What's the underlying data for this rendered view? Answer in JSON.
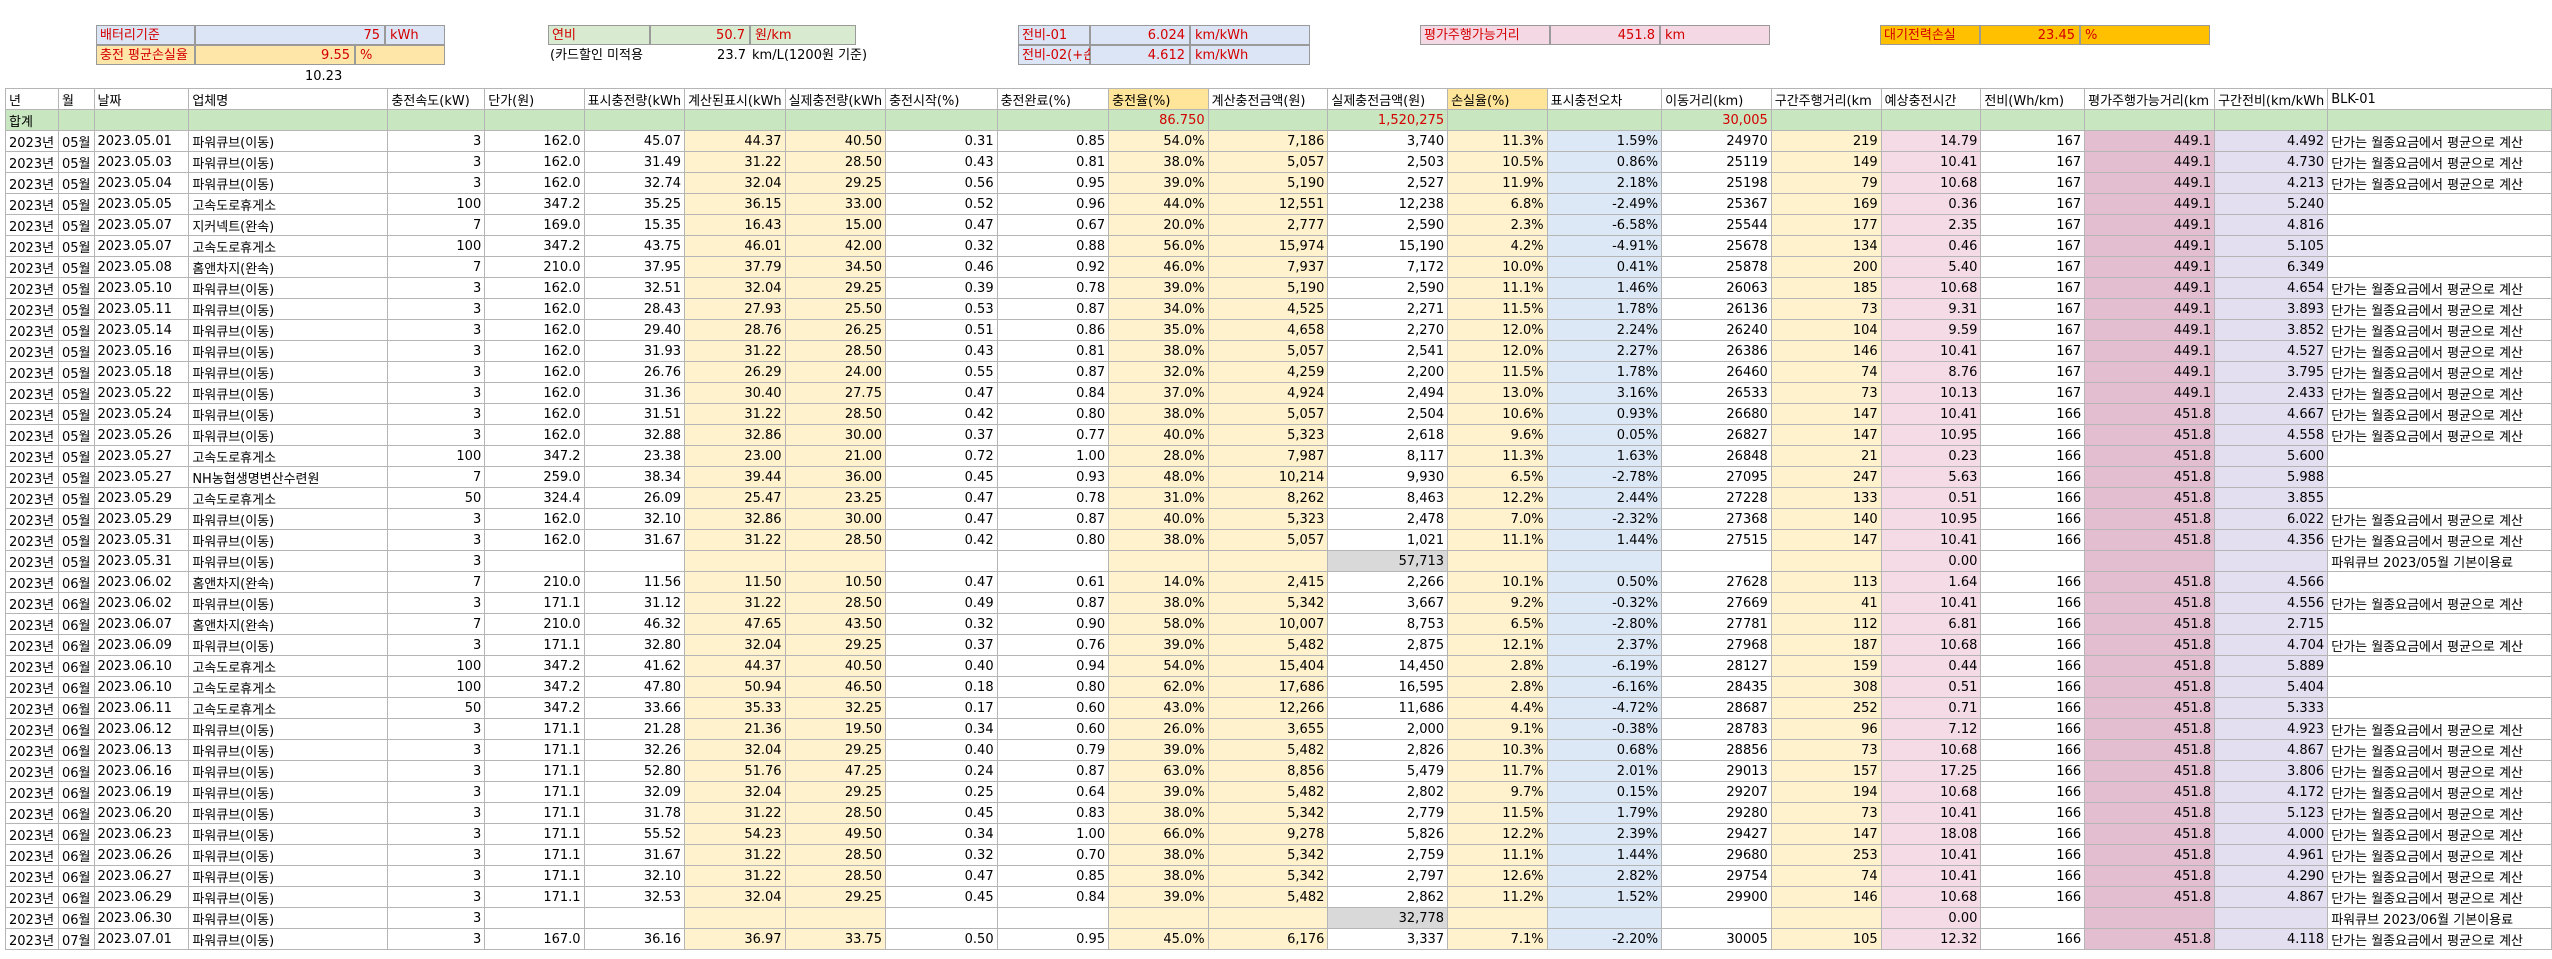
{
  "header": {
    "battery_label": "배터리기준",
    "battery_value": "75",
    "battery_unit": "kWh",
    "charge_loss_label": "충전 평균손실율",
    "charge_loss_value": "9.55",
    "charge_loss_unit": "%",
    "below_value": "10.23",
    "fuel_label": "연비",
    "fuel_value": "50.7",
    "fuel_unit": "원/km",
    "discount_note": "(카드할인 미적용",
    "discount_value": "23.7",
    "discount_unit": "km/L(1200원 기준)",
    "eff1_label": "전비-01",
    "eff1_value": "6.024",
    "eff1_unit": "km/kWh",
    "eff2_label": "전비-02(+손실)",
    "eff2_value": "4.612",
    "eff2_unit": "km/kWh",
    "range_label": "평가주행가능거리",
    "range_value": "451.8",
    "range_unit": "km",
    "standby_label": "대기전력손실",
    "standby_value": "23.45",
    "standby_unit": "%"
  },
  "table": {
    "columns": [
      "년",
      "월",
      "날짜",
      "업체명",
      "충전속도(kW)",
      "단가(원)",
      "표시충전량(kWh",
      "계산된표시(kWh",
      "실제충전량(kWh",
      "충전시작(%)",
      "충전완료(%)",
      "충전율(%)",
      "계산충전금액(원)",
      "실제충전금액(원)",
      "손실율(%)",
      "표시충전오차",
      "이동거리(km)",
      "구간주행거리(km",
      "예상충전시간",
      "전비(Wh/km)",
      "평가주행가능거리(km",
      "구간전비(km/kWh",
      "BLK-01"
    ],
    "summary": {
      "label": "합계",
      "charge_rate": "86.750",
      "actual_amount": "1,520,275",
      "distance": "30,005"
    },
    "rows": [
      [
        "2023년",
        "05월",
        "2023.05.01",
        "파워큐브(이동)",
        "3",
        "162.0",
        "45.07",
        "44.37",
        "40.50",
        "0.31",
        "0.85",
        "54.0%",
        "7,186",
        "3,740",
        "11.3%",
        "1.59%",
        "24970",
        "219",
        "14.79",
        "167",
        "449.1",
        "4.492",
        "단가는 월종요금에서 평균으로 계산"
      ],
      [
        "2023년",
        "05월",
        "2023.05.03",
        "파워큐브(이동)",
        "3",
        "162.0",
        "31.49",
        "31.22",
        "28.50",
        "0.43",
        "0.81",
        "38.0%",
        "5,057",
        "2,503",
        "10.5%",
        "0.86%",
        "25119",
        "149",
        "10.41",
        "167",
        "449.1",
        "4.730",
        "단가는 월종요금에서 평균으로 계산"
      ],
      [
        "2023년",
        "05월",
        "2023.05.04",
        "파워큐브(이동)",
        "3",
        "162.0",
        "32.74",
        "32.04",
        "29.25",
        "0.56",
        "0.95",
        "39.0%",
        "5,190",
        "2,527",
        "11.9%",
        "2.18%",
        "25198",
        "79",
        "10.68",
        "167",
        "449.1",
        "4.213",
        "단가는 월종요금에서 평균으로 계산"
      ],
      [
        "2023년",
        "05월",
        "2023.05.05",
        "고속도로휴게소",
        "100",
        "347.2",
        "35.25",
        "36.15",
        "33.00",
        "0.52",
        "0.96",
        "44.0%",
        "12,551",
        "12,238",
        "6.8%",
        "-2.49%",
        "25367",
        "169",
        "0.36",
        "167",
        "449.1",
        "5.240",
        ""
      ],
      [
        "2023년",
        "05월",
        "2023.05.07",
        "지커넥트(완속)",
        "7",
        "169.0",
        "15.35",
        "16.43",
        "15.00",
        "0.47",
        "0.67",
        "20.0%",
        "2,777",
        "2,590",
        "2.3%",
        "-6.58%",
        "25544",
        "177",
        "2.35",
        "167",
        "449.1",
        "4.816",
        ""
      ],
      [
        "2023년",
        "05월",
        "2023.05.07",
        "고속도로휴게소",
        "100",
        "347.2",
        "43.75",
        "46.01",
        "42.00",
        "0.32",
        "0.88",
        "56.0%",
        "15,974",
        "15,190",
        "4.2%",
        "-4.91%",
        "25678",
        "134",
        "0.46",
        "167",
        "449.1",
        "5.105",
        ""
      ],
      [
        "2023년",
        "05월",
        "2023.05.08",
        "홈앤차지(완속)",
        "7",
        "210.0",
        "37.95",
        "37.79",
        "34.50",
        "0.46",
        "0.92",
        "46.0%",
        "7,937",
        "7,172",
        "10.0%",
        "0.41%",
        "25878",
        "200",
        "5.40",
        "167",
        "449.1",
        "6.349",
        ""
      ],
      [
        "2023년",
        "05월",
        "2023.05.10",
        "파워큐브(이동)",
        "3",
        "162.0",
        "32.51",
        "32.04",
        "29.25",
        "0.39",
        "0.78",
        "39.0%",
        "5,190",
        "2,590",
        "11.1%",
        "1.46%",
        "26063",
        "185",
        "10.68",
        "167",
        "449.1",
        "4.654",
        "단가는 월종요금에서 평균으로 계산"
      ],
      [
        "2023년",
        "05월",
        "2023.05.11",
        "파워큐브(이동)",
        "3",
        "162.0",
        "28.43",
        "27.93",
        "25.50",
        "0.53",
        "0.87",
        "34.0%",
        "4,525",
        "2,271",
        "11.5%",
        "1.78%",
        "26136",
        "73",
        "9.31",
        "167",
        "449.1",
        "3.893",
        "단가는 월종요금에서 평균으로 계산"
      ],
      [
        "2023년",
        "05월",
        "2023.05.14",
        "파워큐브(이동)",
        "3",
        "162.0",
        "29.40",
        "28.76",
        "26.25",
        "0.51",
        "0.86",
        "35.0%",
        "4,658",
        "2,270",
        "12.0%",
        "2.24%",
        "26240",
        "104",
        "9.59",
        "167",
        "449.1",
        "3.852",
        "단가는 월종요금에서 평균으로 계산"
      ],
      [
        "2023년",
        "05월",
        "2023.05.16",
        "파워큐브(이동)",
        "3",
        "162.0",
        "31.93",
        "31.22",
        "28.50",
        "0.43",
        "0.81",
        "38.0%",
        "5,057",
        "2,541",
        "12.0%",
        "2.27%",
        "26386",
        "146",
        "10.41",
        "167",
        "449.1",
        "4.527",
        "단가는 월종요금에서 평균으로 계산"
      ],
      [
        "2023년",
        "05월",
        "2023.05.18",
        "파워큐브(이동)",
        "3",
        "162.0",
        "26.76",
        "26.29",
        "24.00",
        "0.55",
        "0.87",
        "32.0%",
        "4,259",
        "2,200",
        "11.5%",
        "1.78%",
        "26460",
        "74",
        "8.76",
        "167",
        "449.1",
        "3.795",
        "단가는 월종요금에서 평균으로 계산"
      ],
      [
        "2023년",
        "05월",
        "2023.05.22",
        "파워큐브(이동)",
        "3",
        "162.0",
        "31.36",
        "30.40",
        "27.75",
        "0.47",
        "0.84",
        "37.0%",
        "4,924",
        "2,494",
        "13.0%",
        "3.16%",
        "26533",
        "73",
        "10.13",
        "167",
        "449.1",
        "2.433",
        "단가는 월종요금에서 평균으로 계산"
      ],
      [
        "2023년",
        "05월",
        "2023.05.24",
        "파워큐브(이동)",
        "3",
        "162.0",
        "31.51",
        "31.22",
        "28.50",
        "0.42",
        "0.80",
        "38.0%",
        "5,057",
        "2,504",
        "10.6%",
        "0.93%",
        "26680",
        "147",
        "10.41",
        "166",
        "451.8",
        "4.667",
        "단가는 월종요금에서 평균으로 계산"
      ],
      [
        "2023년",
        "05월",
        "2023.05.26",
        "파워큐브(이동)",
        "3",
        "162.0",
        "32.88",
        "32.86",
        "30.00",
        "0.37",
        "0.77",
        "40.0%",
        "5,323",
        "2,618",
        "9.6%",
        "0.05%",
        "26827",
        "147",
        "10.95",
        "166",
        "451.8",
        "4.558",
        "단가는 월종요금에서 평균으로 계산"
      ],
      [
        "2023년",
        "05월",
        "2023.05.27",
        "고속도로휴게소",
        "100",
        "347.2",
        "23.38",
        "23.00",
        "21.00",
        "0.72",
        "1.00",
        "28.0%",
        "7,987",
        "8,117",
        "11.3%",
        "1.63%",
        "26848",
        "21",
        "0.23",
        "166",
        "451.8",
        "5.600",
        ""
      ],
      [
        "2023년",
        "05월",
        "2023.05.27",
        "NH농협생명변산수련원",
        "7",
        "259.0",
        "38.34",
        "39.44",
        "36.00",
        "0.45",
        "0.93",
        "48.0%",
        "10,214",
        "9,930",
        "6.5%",
        "-2.78%",
        "27095",
        "247",
        "5.63",
        "166",
        "451.8",
        "5.988",
        ""
      ],
      [
        "2023년",
        "05월",
        "2023.05.29",
        "고속도로휴게소",
        "50",
        "324.4",
        "26.09",
        "25.47",
        "23.25",
        "0.47",
        "0.78",
        "31.0%",
        "8,262",
        "8,463",
        "12.2%",
        "2.44%",
        "27228",
        "133",
        "0.51",
        "166",
        "451.8",
        "3.855",
        ""
      ],
      [
        "2023년",
        "05월",
        "2023.05.29",
        "파워큐브(이동)",
        "3",
        "162.0",
        "32.10",
        "32.86",
        "30.00",
        "0.47",
        "0.87",
        "40.0%",
        "5,323",
        "2,478",
        "7.0%",
        "-2.32%",
        "27368",
        "140",
        "10.95",
        "166",
        "451.8",
        "6.022",
        "단가는 월종요금에서 평균으로 계산"
      ],
      [
        "2023년",
        "05월",
        "2023.05.31",
        "파워큐브(이동)",
        "3",
        "162.0",
        "31.67",
        "31.22",
        "28.50",
        "0.42",
        "0.80",
        "38.0%",
        "5,057",
        "1,021",
        "11.1%",
        "1.44%",
        "27515",
        "147",
        "10.41",
        "166",
        "451.8",
        "4.356",
        "단가는 월종요금에서 평균으로 계산"
      ],
      [
        "2023년",
        "05월",
        "2023.05.31",
        "파워큐브(이동)",
        "3",
        "",
        "",
        "",
        "",
        "",
        "",
        "",
        "",
        "57,713",
        "",
        "",
        "",
        "",
        "0.00",
        "",
        "",
        "",
        "파워큐브 2023/05월 기본이용료"
      ],
      [
        "2023년",
        "06월",
        "2023.06.02",
        "홈앤차지(완속)",
        "7",
        "210.0",
        "11.56",
        "11.50",
        "10.50",
        "0.47",
        "0.61",
        "14.0%",
        "2,415",
        "2,266",
        "10.1%",
        "0.50%",
        "27628",
        "113",
        "1.64",
        "166",
        "451.8",
        "4.566",
        ""
      ],
      [
        "2023년",
        "06월",
        "2023.06.02",
        "파워큐브(이동)",
        "3",
        "171.1",
        "31.12",
        "31.22",
        "28.50",
        "0.49",
        "0.87",
        "38.0%",
        "5,342",
        "3,667",
        "9.2%",
        "-0.32%",
        "27669",
        "41",
        "10.41",
        "166",
        "451.8",
        "4.556",
        "단가는 월종요금에서 평균으로 계산"
      ],
      [
        "2023년",
        "06월",
        "2023.06.07",
        "홈앤차지(완속)",
        "7",
        "210.0",
        "46.32",
        "47.65",
        "43.50",
        "0.32",
        "0.90",
        "58.0%",
        "10,007",
        "8,753",
        "6.5%",
        "-2.80%",
        "27781",
        "112",
        "6.81",
        "166",
        "451.8",
        "2.715",
        ""
      ],
      [
        "2023년",
        "06월",
        "2023.06.09",
        "파워큐브(이동)",
        "3",
        "171.1",
        "32.80",
        "32.04",
        "29.25",
        "0.37",
        "0.76",
        "39.0%",
        "5,482",
        "2,875",
        "12.1%",
        "2.37%",
        "27968",
        "187",
        "10.68",
        "166",
        "451.8",
        "4.704",
        "단가는 월종요금에서 평균으로 계산"
      ],
      [
        "2023년",
        "06월",
        "2023.06.10",
        "고속도로휴게소",
        "100",
        "347.2",
        "41.62",
        "44.37",
        "40.50",
        "0.40",
        "0.94",
        "54.0%",
        "15,404",
        "14,450",
        "2.8%",
        "-6.19%",
        "28127",
        "159",
        "0.44",
        "166",
        "451.8",
        "5.889",
        ""
      ],
      [
        "2023년",
        "06월",
        "2023.06.10",
        "고속도로휴게소",
        "100",
        "347.2",
        "47.80",
        "50.94",
        "46.50",
        "0.18",
        "0.80",
        "62.0%",
        "17,686",
        "16,595",
        "2.8%",
        "-6.16%",
        "28435",
        "308",
        "0.51",
        "166",
        "451.8",
        "5.404",
        ""
      ],
      [
        "2023년",
        "06월",
        "2023.06.11",
        "고속도로휴게소",
        "50",
        "347.2",
        "33.66",
        "35.33",
        "32.25",
        "0.17",
        "0.60",
        "43.0%",
        "12,266",
        "11,686",
        "4.4%",
        "-4.72%",
        "28687",
        "252",
        "0.71",
        "166",
        "451.8",
        "5.333",
        ""
      ],
      [
        "2023년",
        "06월",
        "2023.06.12",
        "파워큐브(이동)",
        "3",
        "171.1",
        "21.28",
        "21.36",
        "19.50",
        "0.34",
        "0.60",
        "26.0%",
        "3,655",
        "2,000",
        "9.1%",
        "-0.38%",
        "28783",
        "96",
        "7.12",
        "166",
        "451.8",
        "4.923",
        "단가는 월종요금에서 평균으로 계산"
      ],
      [
        "2023년",
        "06월",
        "2023.06.13",
        "파워큐브(이동)",
        "3",
        "171.1",
        "32.26",
        "32.04",
        "29.25",
        "0.40",
        "0.79",
        "39.0%",
        "5,482",
        "2,826",
        "10.3%",
        "0.68%",
        "28856",
        "73",
        "10.68",
        "166",
        "451.8",
        "4.867",
        "단가는 월종요금에서 평균으로 계산"
      ],
      [
        "2023년",
        "06월",
        "2023.06.16",
        "파워큐브(이동)",
        "3",
        "171.1",
        "52.80",
        "51.76",
        "47.25",
        "0.24",
        "0.87",
        "63.0%",
        "8,856",
        "5,479",
        "11.7%",
        "2.01%",
        "29013",
        "157",
        "17.25",
        "166",
        "451.8",
        "3.806",
        "단가는 월종요금에서 평균으로 계산"
      ],
      [
        "2023년",
        "06월",
        "2023.06.19",
        "파워큐브(이동)",
        "3",
        "171.1",
        "32.09",
        "32.04",
        "29.25",
        "0.25",
        "0.64",
        "39.0%",
        "5,482",
        "2,802",
        "9.7%",
        "0.15%",
        "29207",
        "194",
        "10.68",
        "166",
        "451.8",
        "4.172",
        "단가는 월종요금에서 평균으로 계산"
      ],
      [
        "2023년",
        "06월",
        "2023.06.20",
        "파워큐브(이동)",
        "3",
        "171.1",
        "31.78",
        "31.22",
        "28.50",
        "0.45",
        "0.83",
        "38.0%",
        "5,342",
        "2,779",
        "11.5%",
        "1.79%",
        "29280",
        "73",
        "10.41",
        "166",
        "451.8",
        "5.123",
        "단가는 월종요금에서 평균으로 계산"
      ],
      [
        "2023년",
        "06월",
        "2023.06.23",
        "파워큐브(이동)",
        "3",
        "171.1",
        "55.52",
        "54.23",
        "49.50",
        "0.34",
        "1.00",
        "66.0%",
        "9,278",
        "5,826",
        "12.2%",
        "2.39%",
        "29427",
        "147",
        "18.08",
        "166",
        "451.8",
        "4.000",
        "단가는 월종요금에서 평균으로 계산"
      ],
      [
        "2023년",
        "06월",
        "2023.06.26",
        "파워큐브(이동)",
        "3",
        "171.1",
        "31.67",
        "31.22",
        "28.50",
        "0.32",
        "0.70",
        "38.0%",
        "5,342",
        "2,759",
        "11.1%",
        "1.44%",
        "29680",
        "253",
        "10.41",
        "166",
        "451.8",
        "4.961",
        "단가는 월종요금에서 평균으로 계산"
      ],
      [
        "2023년",
        "06월",
        "2023.06.27",
        "파워큐브(이동)",
        "3",
        "171.1",
        "32.10",
        "31.22",
        "28.50",
        "0.47",
        "0.85",
        "38.0%",
        "5,342",
        "2,797",
        "12.6%",
        "2.82%",
        "29754",
        "74",
        "10.41",
        "166",
        "451.8",
        "4.290",
        "단가는 월종요금에서 평균으로 계산"
      ],
      [
        "2023년",
        "06월",
        "2023.06.29",
        "파워큐브(이동)",
        "3",
        "171.1",
        "32.53",
        "32.04",
        "29.25",
        "0.45",
        "0.84",
        "39.0%",
        "5,482",
        "2,862",
        "11.2%",
        "1.52%",
        "29900",
        "146",
        "10.68",
        "166",
        "451.8",
        "4.867",
        "단가는 월종요금에서 평균으로 계산"
      ],
      [
        "2023년",
        "06월",
        "2023.06.30",
        "파워큐브(이동)",
        "3",
        "",
        "",
        "",
        "",
        "",
        "",
        "",
        "",
        "32,778",
        "",
        "",
        "",
        "",
        "0.00",
        "",
        "",
        "",
        "파워큐브 2023/06월 기본이용료"
      ],
      [
        "2023년",
        "07월",
        "2023.07.01",
        "파워큐브(이동)",
        "3",
        "167.0",
        "36.16",
        "36.97",
        "33.75",
        "0.50",
        "0.95",
        "45.0%",
        "6,176",
        "3,337",
        "7.1%",
        "-2.20%",
        "30005",
        "105",
        "12.32",
        "166",
        "451.8",
        "4.118",
        "단가는 월종요금에서 평균으로 계산"
      ]
    ]
  },
  "colors": {
    "blue_cell": "#dbe5f5",
    "green_cell": "#d8ead0",
    "yellow_cell": "#fff2cc",
    "orange_cell": "#ffc000",
    "pink_cell": "#f4d9e4",
    "sum_row": "#c8e6c0",
    "red_text": "#d40000"
  }
}
